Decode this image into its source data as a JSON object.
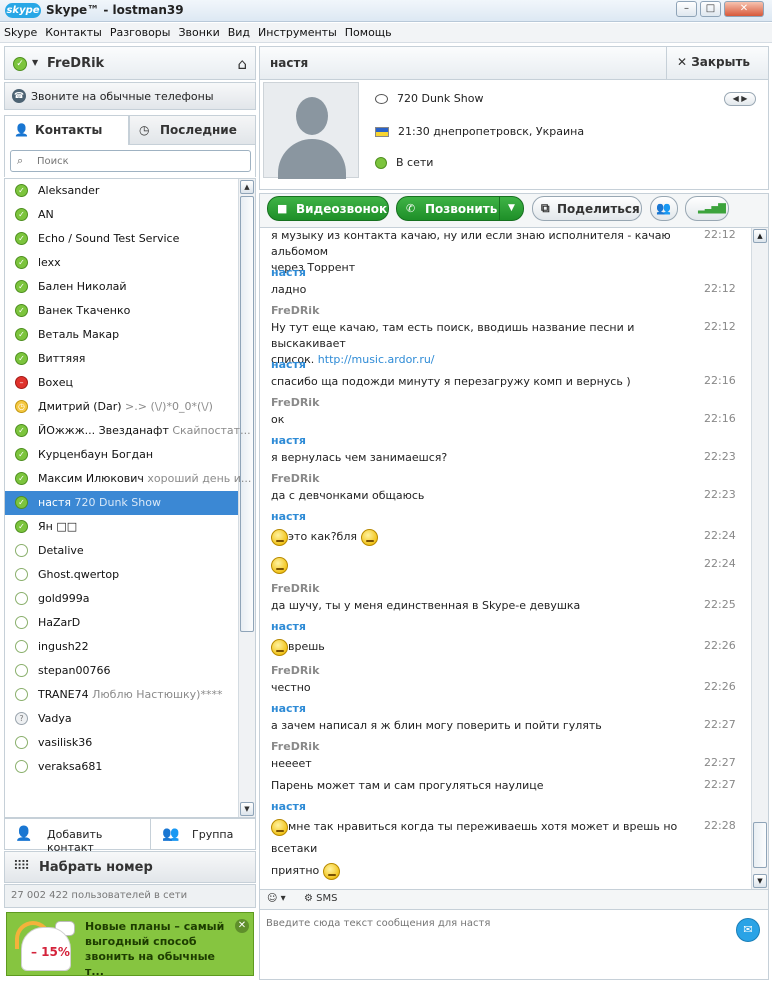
{
  "window": {
    "logo": "skype",
    "title": "Skype™ - lostman39"
  },
  "menu": [
    "Skype",
    "Контакты",
    "Разговоры",
    "Звонки",
    "Вид",
    "Инструменты",
    "Помощь"
  ],
  "user": {
    "name": "FreDRik"
  },
  "call_phones": "Звоните на обычные телефоны",
  "tabs": {
    "contacts": "Контакты",
    "recent": "Последние"
  },
  "search": {
    "placeholder": "Поиск"
  },
  "contacts": [
    {
      "name": "Aleksander",
      "mood": "",
      "status": "online"
    },
    {
      "name": "AN",
      "mood": "",
      "status": "online"
    },
    {
      "name": "Echo / Sound Test Service",
      "mood": "",
      "status": "online"
    },
    {
      "name": "lexx",
      "mood": "",
      "status": "online"
    },
    {
      "name": "Бален Николай",
      "mood": "",
      "status": "online"
    },
    {
      "name": "Ванек Ткаченко",
      "mood": "",
      "status": "online"
    },
    {
      "name": "Веталь Макар",
      "mood": "",
      "status": "online"
    },
    {
      "name": "Виттяяя",
      "mood": "",
      "status": "online"
    },
    {
      "name": "Вохец",
      "mood": "",
      "status": "dnd"
    },
    {
      "name": "Дмитрий (Dar)",
      "mood": ">.> (\\/)*0_0*(\\/)",
      "status": "away"
    },
    {
      "name": "ЙОжжж... Звезданафт",
      "mood": "Скайпостат...",
      "status": "online"
    },
    {
      "name": "Курценбаун Богдан",
      "mood": "",
      "status": "online"
    },
    {
      "name": "Максим Илюкович",
      "mood": "хороший день и...",
      "status": "online"
    },
    {
      "name": "настя",
      "mood": "720 Dunk Show",
      "status": "online",
      "selected": true
    },
    {
      "name": "Ян □□",
      "mood": "",
      "status": "online"
    },
    {
      "name": "Detalive",
      "mood": "",
      "status": "offline"
    },
    {
      "name": "Ghost.qwertop",
      "mood": "",
      "status": "offline"
    },
    {
      "name": "gold999a",
      "mood": "",
      "status": "offline"
    },
    {
      "name": "HaZarD",
      "mood": "",
      "status": "offline"
    },
    {
      "name": "ingush22",
      "mood": "",
      "status": "offline"
    },
    {
      "name": "stepan00766",
      "mood": "",
      "status": "offline"
    },
    {
      "name": "TRANE74",
      "mood": "Люблю Настюшку)****",
      "status": "offline"
    },
    {
      "name": "Vadya",
      "mood": "",
      "status": "unknown"
    },
    {
      "name": "vasilisk36",
      "mood": "",
      "status": "offline"
    },
    {
      "name": "veraksa681",
      "mood": "",
      "status": "offline"
    }
  ],
  "add_contact": "Добавить контакт",
  "group": "Группа",
  "dial": "Набрать номер",
  "user_count": "27 002 422 пользователей в сети",
  "promo": {
    "badge": "– 15%",
    "text": "Новые планы – самый выгодный способ звонить на обычные т...",
    "close": "✕"
  },
  "conversation": {
    "name": "настя",
    "close": "Закрыть",
    "mood": "720 Dunk Show",
    "local_time": "21:30 днепропетровск, Украина",
    "status": "В сети"
  },
  "buttons": {
    "video": "Видеозвонок",
    "call": "Позвонить",
    "share": "Поделиться"
  },
  "messages": [
    {
      "sender": "",
      "type": "me",
      "lines": [
        "я музыку из контакта качаю, ну или если знаю исполнителя - качаю альбомом",
        "через Торрент"
      ],
      "time": "22:12"
    },
    {
      "sender": "настя",
      "type": "her",
      "lines": [
        "ладно"
      ],
      "time": "22:12"
    },
    {
      "sender": "FreDRik",
      "type": "me",
      "lines": [
        "Ну тут еще качаю, там есть поиск, вводишь название песни и выскакивает",
        "список."
      ],
      "link": "http://music.ardor.ru/",
      "time": "22:12"
    },
    {
      "sender": "настя",
      "type": "her",
      "lines": [
        "спасибо ща подожди минуту я перезагружу комп и вернусь )"
      ],
      "time": "22:16"
    },
    {
      "sender": "FreDRik",
      "type": "me",
      "lines": [
        "ок"
      ],
      "time": "22:16"
    },
    {
      "sender": "настя",
      "type": "her",
      "lines": [
        "я вернулась чем занимаешся?"
      ],
      "time": "22:23"
    },
    {
      "sender": "FreDRik",
      "type": "me",
      "lines": [
        "да с девчонками общаюсь"
      ],
      "time": "22:23"
    },
    {
      "sender": "настя",
      "type": "her",
      "lines": [
        "это как?бля"
      ],
      "time": "22:24"
    },
    {
      "sender": "",
      "type": "her",
      "lines": [
        ""
      ],
      "time": "22:24"
    },
    {
      "sender": "FreDRik",
      "type": "me",
      "lines": [
        "да шучу, ты у меня единственная в Skype-е девушка"
      ],
      "time": "22:25"
    },
    {
      "sender": "настя",
      "type": "her",
      "lines": [
        "врешь"
      ],
      "time": "22:26"
    },
    {
      "sender": "FreDRik",
      "type": "me",
      "lines": [
        "честно"
      ],
      "time": "22:26"
    },
    {
      "sender": "настя",
      "type": "her",
      "lines": [
        "а зачем написал я ж блин могу поверить и пойти гулять"
      ],
      "time": "22:27"
    },
    {
      "sender": "FreDRik",
      "type": "me",
      "lines": [
        "нееeeт"
      ],
      "time": "22:27"
    },
    {
      "sender": "",
      "type": "me",
      "lines": [
        "Парень может там и сам прогуляться наулице"
      ],
      "time": "22:27"
    },
    {
      "sender": "настя",
      "type": "her",
      "lines": [
        "мне так нравиться когда ты переживаешь хотя может и врешь но всетаки",
        "приятно"
      ],
      "time": "22:28"
    }
  ],
  "input": {
    "sms": "SMS",
    "placeholder": "Введите сюда текст сообщения для настя"
  }
}
